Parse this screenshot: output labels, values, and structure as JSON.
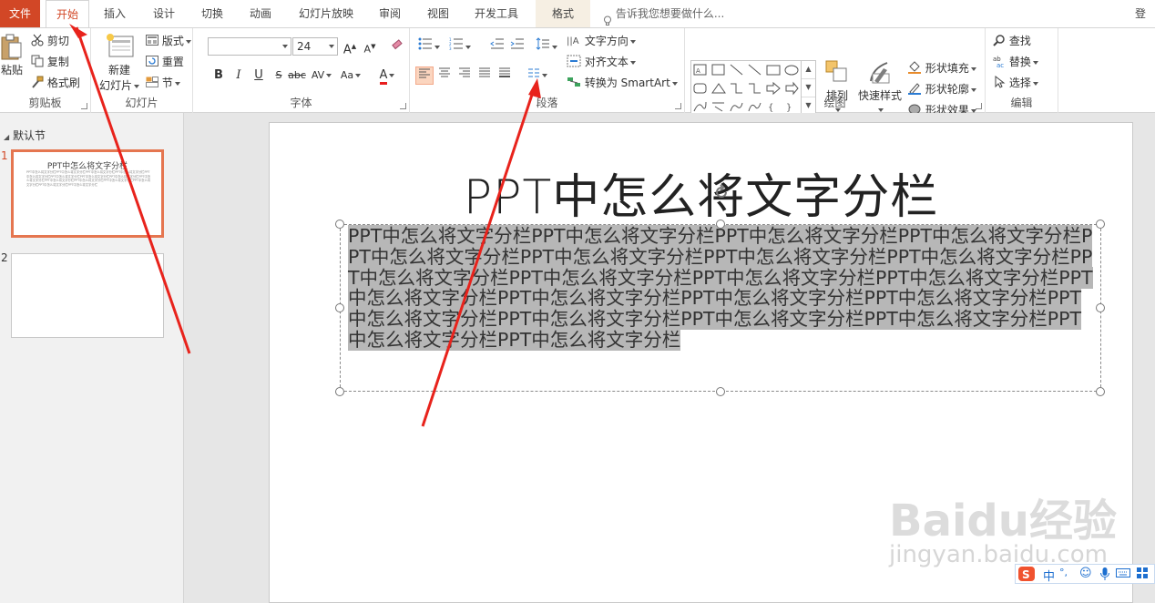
{
  "tabs": {
    "file": "文件",
    "home": "开始",
    "insert": "插入",
    "design": "设计",
    "transitions": "切换",
    "animations": "动画",
    "slideshow": "幻灯片放映",
    "review": "审阅",
    "view": "视图",
    "developer": "开发工具",
    "format": "格式"
  },
  "tellme": "告诉我您想要做什么...",
  "login": "登录",
  "clipboard": {
    "paste": "粘贴",
    "cut": "剪切",
    "copy": "复制",
    "painter": "格式刷",
    "label": "剪贴板"
  },
  "slides_group": {
    "new_slide_line1": "新建",
    "new_slide_line2": "幻灯片",
    "layout": "版式",
    "reset": "重置",
    "section": "节",
    "label": "幻灯片"
  },
  "font": {
    "name_value": "",
    "size_value": "24",
    "label": "字体",
    "color_accent": "#e81e1e"
  },
  "paragraph": {
    "text_direction": "文字方向",
    "align_text": "对齐文本",
    "smartart": "转换为 SmartArt",
    "label": "段落"
  },
  "drawing": {
    "arrange": "排列",
    "quick_styles": "快速样式",
    "shape_fill": "形状填充",
    "shape_outline": "形状轮廓",
    "shape_effects": "形状效果",
    "label": "绘图"
  },
  "editing": {
    "find": "查找",
    "replace": "替换",
    "select": "选择",
    "label": "编辑"
  },
  "left_pane": {
    "section_name": "默认节",
    "slide1_num": "1",
    "slide2_num": "2",
    "thumb_title": "PPT中怎么将文字分栏",
    "thumb_body": "PPT中怎么将文字分栏PPT中怎么将文字分栏PPT中怎么将文字分栏PPT中怎么将文字分栏PPT中怎么将文字分栏PPT中怎么将文字分栏PPT中怎么将文字分栏PPT中怎么将文字分栏PPT中怎么将文字分栏PPT中怎么将文字分栏PPT中怎么将文字分栏PPT中怎么将文字分栏PPT中怎么将文字分栏PPT中怎么将文字分栏PPT中怎么将文字分栏"
  },
  "slide": {
    "title": "PPT中怎么将文字分栏",
    "body": "PPT中怎么将文字分栏PPT中怎么将文字分栏PPT中怎么将文字分栏PPT中怎么将文字分栏PPT中怎么将文字分栏PPT中怎么将文字分栏PPT中怎么将文字分栏PPT中怎么将文字分栏PPT中怎么将文字分栏PPT中怎么将文字分栏PPT中怎么将文字分栏PPT中怎么将文字分栏PPT中怎么将文字分栏PPT中怎么将文字分栏PPT中怎么将文字分栏PPT中怎么将文字分栏PPT中怎么将文字分栏PPT中怎么将文字分栏PPT中怎么将文字分栏PPT中怎么将文字分栏PPT中怎么将文字分栏PPT中怎么将文字分栏"
  },
  "watermark": {
    "logo": "Baidu经验",
    "url": "jingyan.baidu.com"
  },
  "ime": {
    "lang": "中",
    "punct": "°,"
  },
  "colors": {
    "file_tab": "#d24726",
    "accent": "#d24726",
    "annotation_arrow": "#e8231c",
    "selection_highlight": "#b7b7b7"
  }
}
